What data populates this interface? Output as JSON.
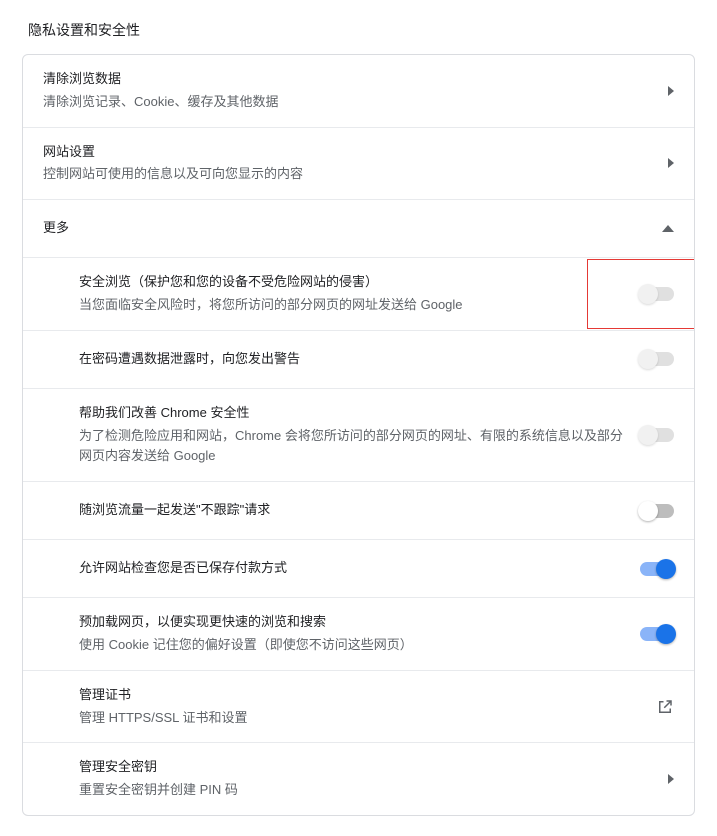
{
  "page": {
    "title": "隐私设置和安全性"
  },
  "topRows": [
    {
      "title": "清除浏览数据",
      "sub": "清除浏览记录、Cookie、缓存及其他数据"
    },
    {
      "title": "网站设置",
      "sub": "控制网站可使用的信息以及可向您显示的内容"
    }
  ],
  "more": {
    "label": "更多"
  },
  "settings": [
    {
      "id": "safe-browsing",
      "title": "安全浏览（保护您和您的设备不受危险网站的侵害）",
      "sub": "当您面临安全风险时，将您所访问的部分网页的网址发送给 Google",
      "type": "toggle",
      "state": "disabled",
      "highlight": true
    },
    {
      "id": "password-leak",
      "title": "在密码遭遇数据泄露时，向您发出警告",
      "sub": "",
      "type": "toggle",
      "state": "disabled"
    },
    {
      "id": "help-improve",
      "title": "帮助我们改善 Chrome 安全性",
      "sub": "为了检测危险应用和网站，Chrome 会将您所访问的部分网页的网址、有限的系统信息以及部分网页内容发送给 Google",
      "type": "toggle",
      "state": "disabled"
    },
    {
      "id": "do-not-track",
      "title": "随浏览流量一起发送\"不跟踪\"请求",
      "sub": "",
      "type": "toggle",
      "state": "off"
    },
    {
      "id": "payment-check",
      "title": "允许网站检查您是否已保存付款方式",
      "sub": "",
      "type": "toggle",
      "state": "on"
    },
    {
      "id": "preload",
      "title": "预加载网页，以便实现更快速的浏览和搜索",
      "sub": "使用 Cookie 记住您的偏好设置（即使您不访问这些网页）",
      "type": "toggle",
      "state": "on"
    },
    {
      "id": "manage-certs",
      "title": "管理证书",
      "sub": "管理 HTTPS/SSL 证书和设置",
      "type": "external"
    },
    {
      "id": "security-keys",
      "title": "管理安全密钥",
      "sub": "重置安全密钥并创建 PIN 码",
      "type": "arrow"
    }
  ]
}
